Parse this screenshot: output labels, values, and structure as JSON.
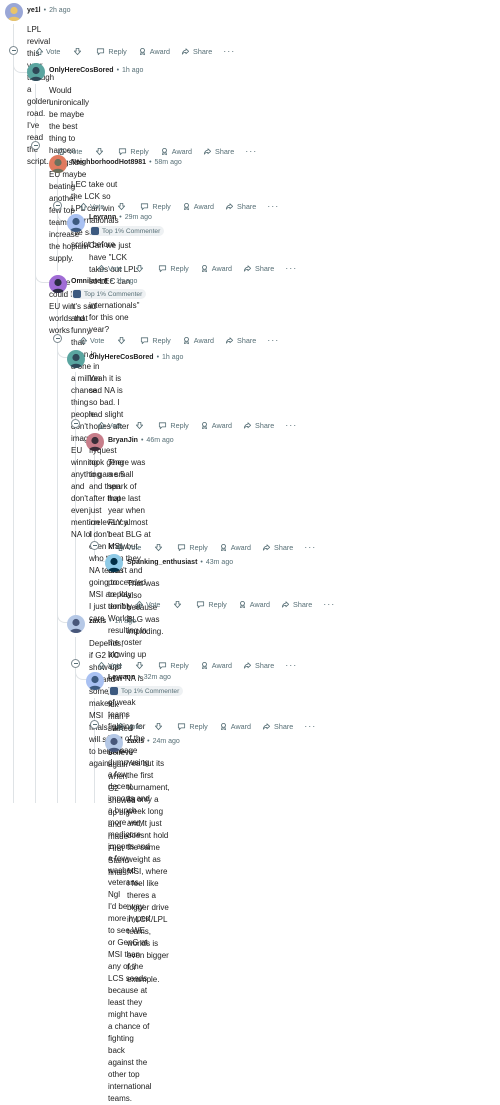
{
  "actions": {
    "vote": "Vote",
    "reply": "Reply",
    "award": "Award",
    "share": "Share",
    "more": "···"
  },
  "comments": [
    {
      "user": "ye1l",
      "time": "2h ago",
      "flair": "",
      "lines": [
        "LPL revival this year through a golden road. I've read the script."
      ]
    },
    {
      "user": "OnlyHereCosBored",
      "time": "1h ago",
      "flair": "",
      "lines": [
        "Would unironically be maybe the best thing to happen alongside EU maybe beating another few top",
        "teams to increase the hopium supply.",
        "",
        "Or we could have EU win worlds that works"
      ]
    },
    {
      "user": "NeighborhoodHot8981",
      "time": "58m ago",
      "flair": "",
      "lines": [
        "LEC take out the LCK so LPL can win internationals i've seen this script before"
      ]
    },
    {
      "user": "Leyrann",
      "time": "29m ago",
      "flair": "Top 1% Commenter",
      "lines": [
        "Can we just have \"LCK takes out LPL so LEC can win internationals\" for this one year?"
      ]
    },
    {
      "user": "Omnilatent",
      "time": "1h ago",
      "flair": "Top 1% Commenter",
      "lines": [
        "It's sad and funny that even in a one in a million chance thing people don't imagine EU winning",
        "anything and don't even mention NA lol"
      ]
    },
    {
      "user": "OnlyHereCosBored",
      "time": "1h ago",
      "flair": "",
      "lines": [
        "Yeah it is sad NA is so bad. I had slight hopes after that flyquest took geng to game 5 and then",
        "after that just irrelevancy. I don't even know who the NA teams going to MSI are lol I just don't",
        "care"
      ]
    },
    {
      "user": "BryanJin",
      "time": "46m ago",
      "flair": "",
      "lines": [
        "There was a small spark of hope last year when FLY almost beat BLG at MSI, but then they",
        "didn't and proceeded to play terribly at Worlds resulting in the roster blowing up and",
        "now NA is just a bunch of weak teams fighting for king of the garbage dump using a few",
        "decent imports and a bunch more very mediocre imports and a few washed veterans. Ngl",
        "I'd be way more hyped to see WE or GenG at MSI than any of the LCS seeds because at",
        "least they might have a chance of fighting back against the other top international teams."
      ]
    },
    {
      "user": "Spanking_enthusiast",
      "time": "43m ago",
      "flair": "",
      "lines": [
        "That was also because BLG was imploding."
      ]
    },
    {
      "user": "zaxls",
      "time": "1h ago",
      "flair": "",
      "lines": [
        "Depends, if G2 KC show up big and someone makes MSI finals, we will start to believe again."
      ]
    },
    {
      "user": "Leyrann",
      "time": "32m ago",
      "flair": "Top 1% Commenter",
      "lines": [
        "Idk man I started to believe again when G2 showed up big and made First Stand finals."
      ]
    },
    {
      "user": "zaxls",
      "time": "24m ago",
      "flair": "",
      "lines": [
        "Yea but its the first tournament, its only a week long and It just doesnt hold the same",
        "weight as MSI, where I feel like theres a bigger drive in LCK/LPL teams, worlds is",
        "even bigger for example."
      ]
    }
  ],
  "colors": {
    "text": "#1c1c1c",
    "meta": "#576f76",
    "rail": "#dfe3e6",
    "flair_bg": "#eef1f3"
  }
}
